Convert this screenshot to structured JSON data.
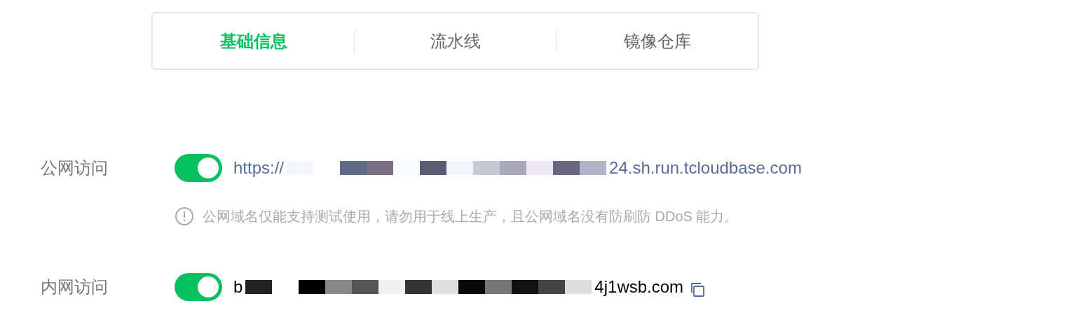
{
  "tabs": [
    {
      "label": "基础信息",
      "selected": true
    },
    {
      "label": "流水线",
      "selected": false
    },
    {
      "label": "镜像仓库",
      "selected": false
    }
  ],
  "access": [
    {
      "label": "公网访问",
      "on": true,
      "kind": "link",
      "url_start": "https://",
      "url_end": "24.sh.run.tcloudbase.com",
      "note": "公网域名仅能支持测试使用，请勿用于线上生产，且公网域名没有防刷防 DDoS 能力。"
    },
    {
      "label": "内网访问",
      "on": true,
      "kind": "plain",
      "url_start": "b",
      "url_end": "4j1wsb.com",
      "copyable": true
    }
  ]
}
